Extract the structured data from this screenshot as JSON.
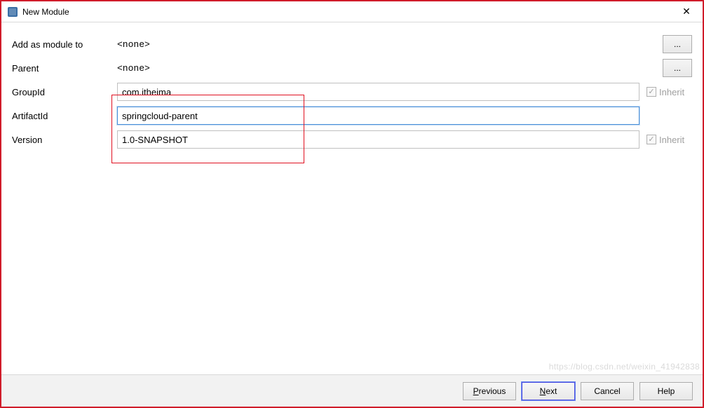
{
  "window": {
    "title": "New Module",
    "close_glyph": "✕"
  },
  "form": {
    "add_module_label": "Add as module to",
    "add_module_value": "<none>",
    "parent_label": "Parent",
    "parent_value": "<none>",
    "groupid_label": "GroupId",
    "groupid_value": "com.itheima",
    "artifactid_label": "ArtifactId",
    "artifactid_value": "springcloud-parent",
    "version_label": "Version",
    "version_value": "1.0-SNAPSHOT",
    "inherit_label": "Inherit",
    "ellipsis": "..."
  },
  "buttons": {
    "previous": "Previous",
    "previous_key": "P",
    "next": "Next",
    "next_key": "N",
    "cancel": "Cancel",
    "help": "Help"
  },
  "watermark": "https://blog.csdn.net/weixin_41942838"
}
